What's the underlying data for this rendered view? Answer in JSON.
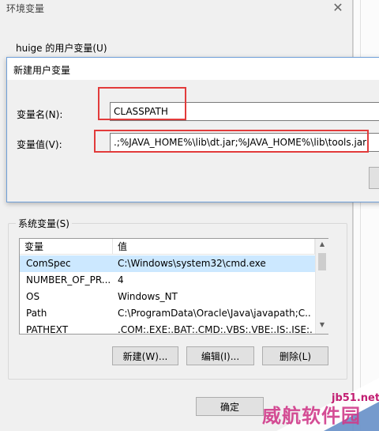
{
  "env_dialog": {
    "title": "环境变量",
    "close_glyph": "✕",
    "user_vars_label": "huige 的用户变量(U)",
    "system_vars_label": "系统变量(S)",
    "ok_label": "确定"
  },
  "new_var_dialog": {
    "title": "新建用户变量",
    "name_label": "变量名(N):",
    "value_label": "变量值(V):",
    "name_value": "CLASSPATH",
    "value_value": ".;%JAVA_HOME%\\lib\\dt.jar;%JAVA_HOME%\\lib\\tools.jar"
  },
  "system_table": {
    "headers": [
      "变量",
      "值"
    ],
    "rows": [
      {
        "name": "ComSpec",
        "value": "C:\\Windows\\system32\\cmd.exe"
      },
      {
        "name": "NUMBER_OF_PR...",
        "value": "4"
      },
      {
        "name": "OS",
        "value": "Windows_NT"
      },
      {
        "name": "Path",
        "value": "C:\\ProgramData\\Oracle\\Java\\javapath;C..."
      },
      {
        "name": "PATHEXT",
        "value": ".COM;.EXE;.BAT;.CMD;.VBS;.VBE;.JS;.JSE;..."
      }
    ]
  },
  "system_buttons": {
    "new_label": "新建(W)...",
    "edit_label": "编辑(I)...",
    "delete_label": "删除(L)"
  },
  "watermark": {
    "site": "jb51.net",
    "text": "威航软件园"
  },
  "colors": {
    "highlight_box": "#e23b3b",
    "selected_row": "#cce8ff",
    "dialog_border": "#6f9fd8"
  }
}
